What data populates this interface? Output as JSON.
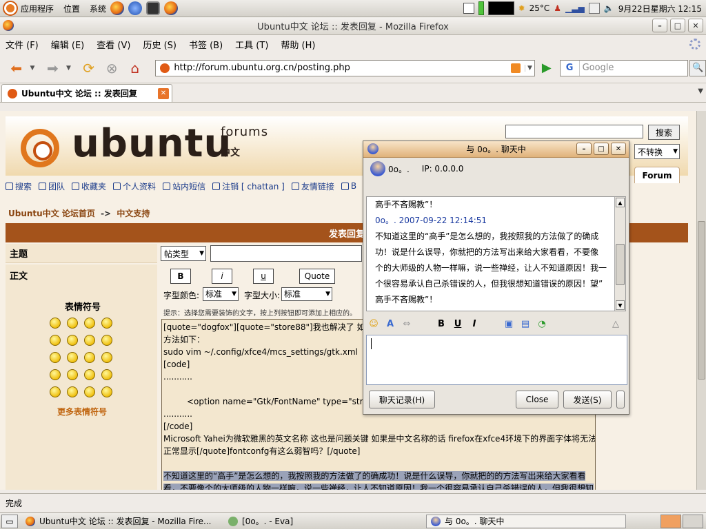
{
  "panel": {
    "applications": "应用程序",
    "places": "位置",
    "system": "系统",
    "temperature": "25°C",
    "clock": "9月22日星期六 12:15"
  },
  "window": {
    "title": "Ubuntu中文 论坛 :: 发表回复 - Mozilla Firefox"
  },
  "menu": [
    "文件 (F)",
    "编辑 (E)",
    "查看 (V)",
    "历史 (S)",
    "书签 (B)",
    "工具 (T)",
    "帮助 (H)"
  ],
  "nav": {
    "url": "http://forum.ubuntu.org.cn/posting.php",
    "search_placeholder": "Google",
    "search_engine": "G"
  },
  "tab": {
    "label": "Ubuntu中文 论坛 :: 发表回复"
  },
  "page": {
    "logo_text": "ubuntu",
    "forums_word": "forums",
    "zh_word": "中文",
    "top_search_button": "搜索",
    "convert_select": "不转换",
    "forum_tab": "Forum",
    "links": [
      "搜索",
      "团队",
      "收藏夹",
      "个人资料",
      "站内短信",
      "注销 [ chattan ]",
      "友情链接",
      "B"
    ],
    "crumb_home": "Ubuntu中文 论坛首页",
    "crumb_sep": "->",
    "crumb_current": "中文支持",
    "post_header": "发表回复",
    "subject_label": "主题",
    "body_label": "正文",
    "type_select": "帖类型",
    "fmt_bold": "B",
    "fmt_italic": "i",
    "fmt_underline": "u",
    "fmt_quote": "Quote",
    "font_color_label": "字型颜色:",
    "font_color_value": "标准",
    "font_size_label": "字型大小:",
    "font_size_value": "标准",
    "hint": "提示：选择您需要装饰的文字，按上列按钮即可添加上相应的。",
    "smiley_title": "表情符号",
    "more_smileys": "更多表情符号",
    "editor_lines": [
      "[quote=\"dogfox\"][quote=\"store88\"]我也解决了 如果",
      "方法如下：",
      "sudo vim ~/.config/xfce4/mcs_settings/gtk.xml",
      "[code]",
      "...........",
      "",
      "<option name=\"Gtk/FontName\" type=\"string",
      "...........",
      "[/code]",
      "Microsoft Yahei为微软雅黑的英文名称 这也是问题关键 如果是中文名称的话 firefox在xfce4环境下的界面字体将无法",
      "正常显示[/quote]fontconfg有这么弱智吗？[/quote]",
      ""
    ],
    "editor_selected": [
      "不知道这里的“高手”是怎么想的，我按照我的方法做了的确成功！说是什么误导，你就把的的方法写出来给大家看看",
      "看，不要像个的大师级的人物一样嘛，说一些禅经，让人不知道原因！我一个很容易承认自己杀错误的人，但我很想知"
    ]
  },
  "status": "完成",
  "taskbar": {
    "firefox_task": "Ubuntu中文 论坛 :: 发表回复 - Mozilla Fire...",
    "eva_task": "[0o。. - Eva]",
    "chat_task": "与 0o。. 聊天中"
  },
  "chat": {
    "title": "与 0o。. 聊天中",
    "user_name": "0o。.",
    "user_ip": "IP: 0.0.0.0",
    "history_top": "高手不吝赐教”！",
    "meta": "0o。. 2007-09-22 12:14:51",
    "message_lines": [
      "不知道这里的“高手”是怎么想的，我按照我的方法做了的确成",
      "功！说是什么误导，你就把的方法写出来给大家看看，不要像",
      "个的大师级的人物一样嘛，说一些禅经，让人不知道原因！我一",
      "个很容易承认自己杀错误的人，但我很想知道错误的原因！望”",
      "高手不吝赐教”！"
    ],
    "history_button": "聊天记录(H)",
    "close_button": "Close",
    "send_button": "发送(S)"
  }
}
